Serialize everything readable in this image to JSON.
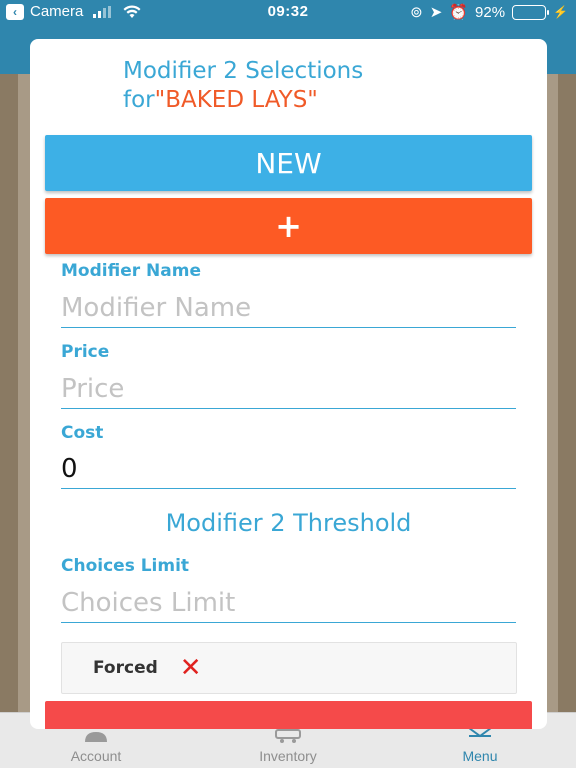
{
  "status_bar": {
    "back_app": "Camera",
    "time": "09:32",
    "battery_percent": "92%",
    "battery_level": 0.92
  },
  "modal": {
    "title_prefix": "Modifier 2 Selections",
    "title_for": "for",
    "item_name": "\"BAKED LAYS\"",
    "new_button": "NEW",
    "add_button": "+",
    "fields": {
      "modifier_name": {
        "label": "Modifier Name",
        "placeholder": "Modifier Name",
        "value": ""
      },
      "price": {
        "label": "Price",
        "placeholder": "Price",
        "value": ""
      },
      "cost": {
        "label": "Cost",
        "placeholder": "",
        "value": "0"
      },
      "choices_limit": {
        "label": "Choices Limit",
        "placeholder": "Choices Limit",
        "value": ""
      }
    },
    "threshold_title": "Modifier 2 Threshold",
    "forced": {
      "label": "Forced",
      "icon": "x-icon",
      "state": "off"
    }
  },
  "tab_bar": {
    "tabs": [
      {
        "label": "Account",
        "icon": "account-icon"
      },
      {
        "label": "Inventory",
        "icon": "inventory-icon"
      },
      {
        "label": "Menu",
        "icon": "menu-icon",
        "active": true
      }
    ]
  },
  "colors": {
    "accent_blue": "#3aa7d5",
    "button_blue": "#3db0e6",
    "button_orange": "#fd5a24",
    "item_orange": "#f05a28",
    "danger_red": "#e0221f"
  }
}
